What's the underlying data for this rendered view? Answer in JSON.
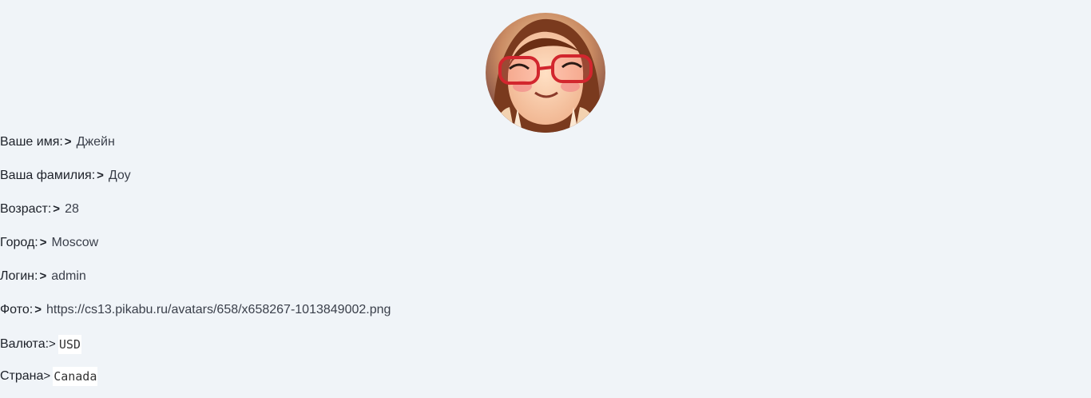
{
  "profile": {
    "avatar_icon": "user-avatar-photo",
    "rows": [
      {
        "label": "Ваше имя:",
        "sep": ">",
        "value": "Джейн"
      },
      {
        "label": "Ваша фамилия:",
        "sep": ">",
        "value": "Доу"
      },
      {
        "label": "Возраст:",
        "sep": ">",
        "value": "28"
      },
      {
        "label": "Город:",
        "sep": ">",
        "value": "Moscow"
      },
      {
        "label": "Логин:",
        "sep": ">",
        "value": "admin"
      },
      {
        "label": "Фото:",
        "sep": ">",
        "value": "https://cs13.pikabu.ru/avatars/658/x658267-1013849002.png"
      },
      {
        "label": "Валюта:",
        "sep": ">",
        "value": "USD"
      },
      {
        "label": "Страна",
        "sep": ">",
        "value": "Canada"
      }
    ]
  }
}
